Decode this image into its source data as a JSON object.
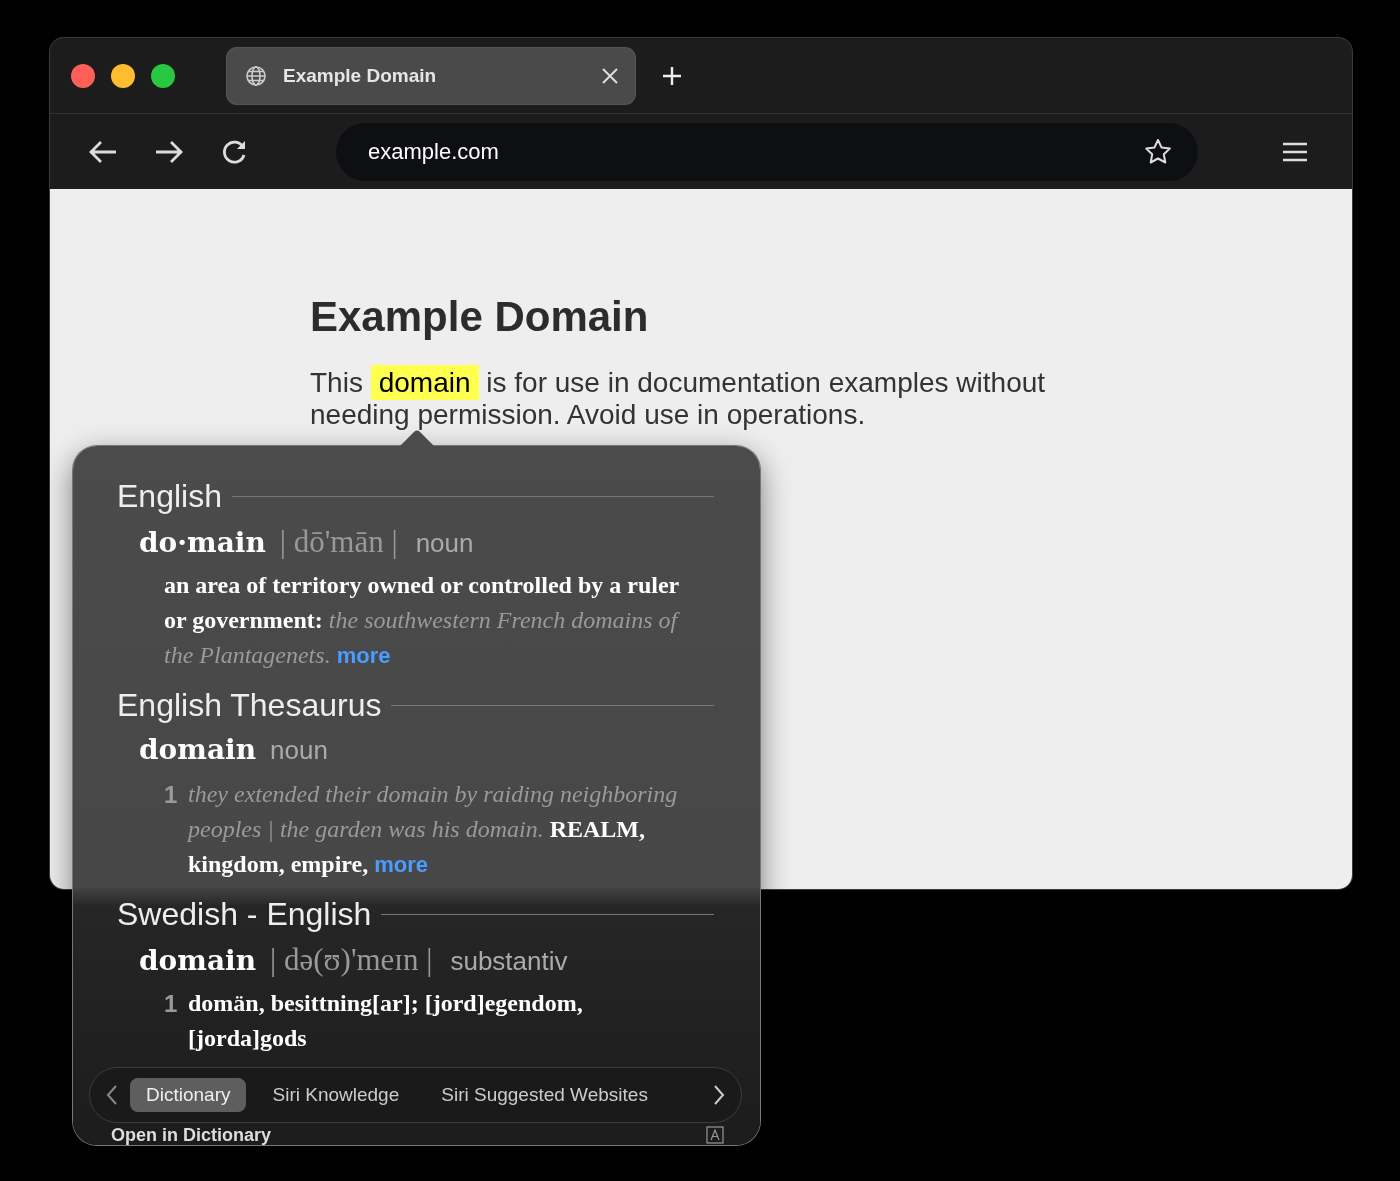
{
  "tab": {
    "title": "Example Domain",
    "selected": true
  },
  "address_bar": {
    "value": "example.com"
  },
  "page": {
    "heading": "Example Domain",
    "paragraph_before": "This",
    "highlighted_word": "domain",
    "paragraph_after": "is for use in documentation examples without needing permission. Avoid use in operations."
  },
  "lookup": {
    "sections": [
      {
        "title": "English",
        "entries": [
          {
            "headword": "do·main",
            "pronunciation": "| dō'mān |",
            "part_of_speech": "noun",
            "senses": [
              {
                "text": "an area of territory owned or controlled by a ruler or government: *the southwestern French domains of the Plantagenets.*",
                "more": "more"
              }
            ]
          }
        ]
      },
      {
        "title": "English Thesaurus",
        "entries": [
          {
            "headword": "domain",
            "part_of_speech": "noun",
            "senses": [
              {
                "number": "1",
                "text": "*they extended their domain by raiding neighboring peoples | the garden was his domain.* REALM, kingdom, empire,",
                "more": "more"
              }
            ]
          }
        ]
      },
      {
        "title": "Swedish - English",
        "entries": [
          {
            "headword": "domain",
            "pronunciation": "| də(ʊ)'meɪn |",
            "part_of_speech": "substantiv",
            "senses": [
              {
                "number": "1",
                "text": "domän, besittning[ar]; [jord]egendom, [jorda]gods"
              }
            ]
          }
        ]
      }
    ],
    "tabs": [
      {
        "label": "Dictionary",
        "selected": true
      },
      {
        "label": "Siri Knowledge",
        "selected": false
      },
      {
        "label": "Siri Suggested Websites",
        "selected": false
      }
    ],
    "footer_link": "Open in Dictionary"
  }
}
